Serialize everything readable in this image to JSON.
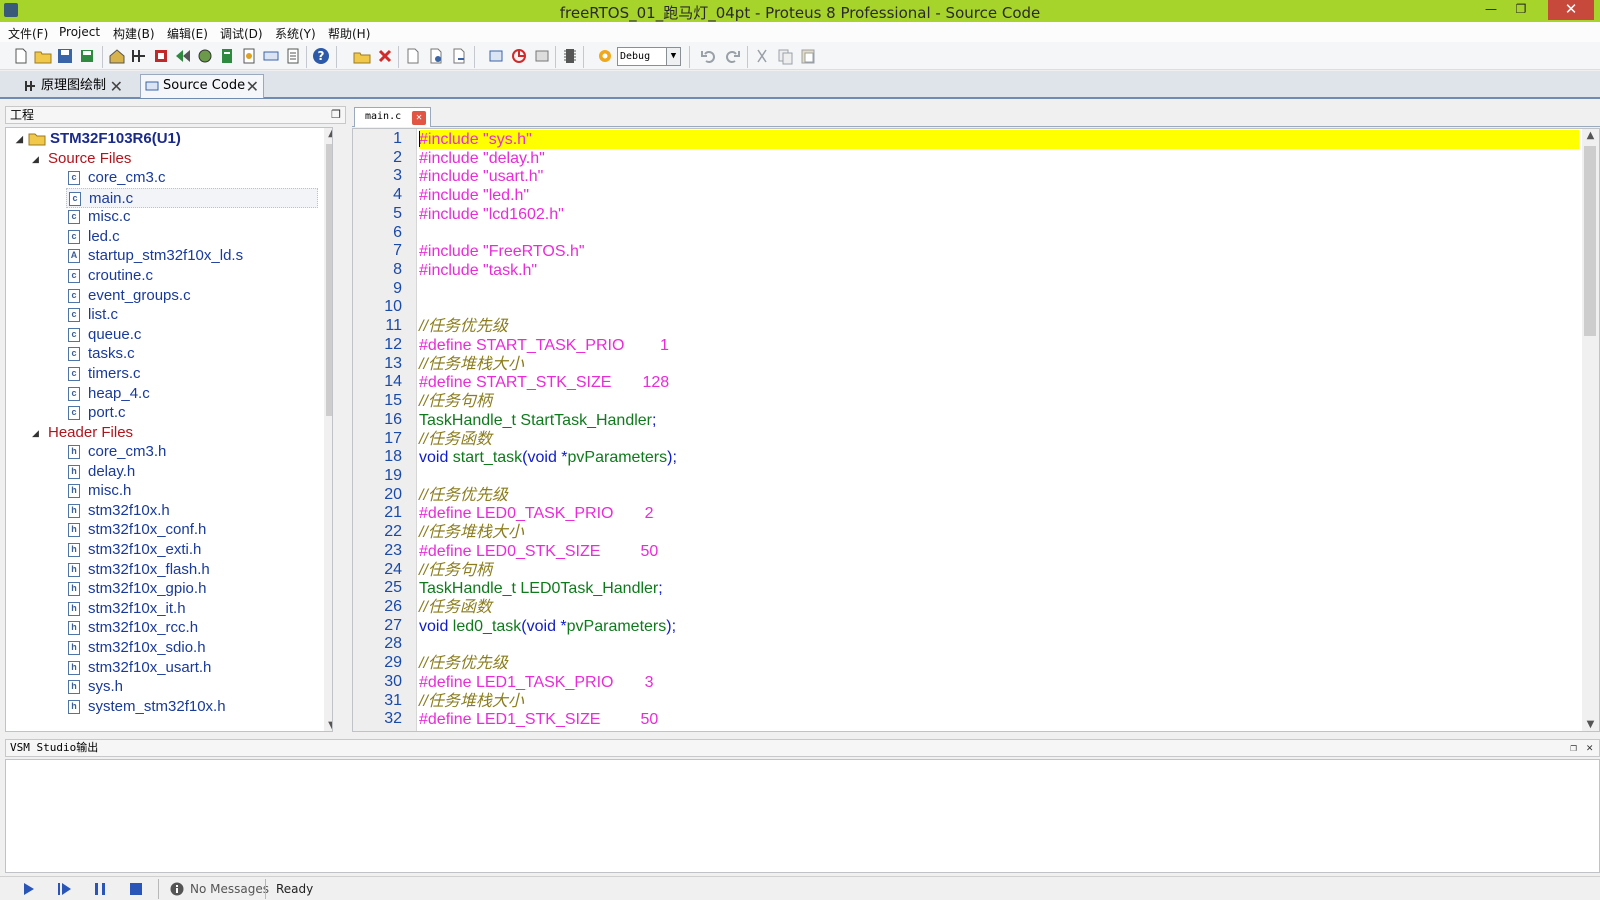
{
  "window": {
    "title": "freeRTOS_01_跑马灯_04pt - Proteus 8 Professional - Source Code",
    "minimize": "—",
    "restore": "❐",
    "close": "✕"
  },
  "menu": [
    "文件(F)",
    "Project",
    "构建(B)",
    "编辑(E)",
    "调试(D)",
    "系统(Y)",
    "帮助(H)"
  ],
  "toolbar": {
    "build_config": "Debug"
  },
  "doc_tabs": [
    {
      "label": "原理图绘制",
      "icon": "schematic-icon"
    },
    {
      "label": "Source Code",
      "icon": "source-code-icon"
    }
  ],
  "project_panel": {
    "header": "工程",
    "root": "STM32F103R6(U1)",
    "source_group": "Source Files",
    "source_files": [
      {
        "name": "core_cm3.c",
        "type": "c"
      },
      {
        "name": "main.c",
        "type": "c"
      },
      {
        "name": "misc.c",
        "type": "c"
      },
      {
        "name": "led.c",
        "type": "c"
      },
      {
        "name": "startup_stm32f10x_ld.s",
        "type": "A"
      },
      {
        "name": "croutine.c",
        "type": "c"
      },
      {
        "name": "event_groups.c",
        "type": "c"
      },
      {
        "name": "list.c",
        "type": "c"
      },
      {
        "name": "queue.c",
        "type": "c"
      },
      {
        "name": "tasks.c",
        "type": "c"
      },
      {
        "name": "timers.c",
        "type": "c"
      },
      {
        "name": "heap_4.c",
        "type": "c"
      },
      {
        "name": "port.c",
        "type": "c"
      }
    ],
    "header_group": "Header Files",
    "header_files": [
      {
        "name": "core_cm3.h",
        "type": "h"
      },
      {
        "name": "delay.h",
        "type": "h"
      },
      {
        "name": "misc.h",
        "type": "h"
      },
      {
        "name": "stm32f10x.h",
        "type": "h"
      },
      {
        "name": "stm32f10x_conf.h",
        "type": "h"
      },
      {
        "name": "stm32f10x_exti.h",
        "type": "h"
      },
      {
        "name": "stm32f10x_flash.h",
        "type": "h"
      },
      {
        "name": "stm32f10x_gpio.h",
        "type": "h"
      },
      {
        "name": "stm32f10x_it.h",
        "type": "h"
      },
      {
        "name": "stm32f10x_rcc.h",
        "type": "h"
      },
      {
        "name": "stm32f10x_sdio.h",
        "type": "h"
      },
      {
        "name": "stm32f10x_usart.h",
        "type": "h"
      },
      {
        "name": "sys.h",
        "type": "h"
      },
      {
        "name": "system_stm32f10x.h",
        "type": "h"
      }
    ]
  },
  "editor": {
    "tab": "main.c",
    "lines": [
      {
        "n": "1",
        "t": [
          [
            "#include \"sys.h\"",
            "pp"
          ]
        ]
      },
      {
        "n": "2",
        "t": [
          [
            "#include \"delay.h\"",
            "pp"
          ]
        ]
      },
      {
        "n": "3",
        "t": [
          [
            "#include \"usart.h\"",
            "pp"
          ]
        ]
      },
      {
        "n": "4",
        "t": [
          [
            "#include \"led.h\"",
            "pp"
          ]
        ]
      },
      {
        "n": "5",
        "t": [
          [
            "#include \"lcd1602.h\"",
            "pp"
          ]
        ]
      },
      {
        "n": "6",
        "t": []
      },
      {
        "n": "7",
        "t": [
          [
            "#include \"FreeRTOS.h\"",
            "pp"
          ]
        ]
      },
      {
        "n": "8",
        "t": [
          [
            "#include \"task.h\"",
            "pp"
          ]
        ]
      },
      {
        "n": "9",
        "t": []
      },
      {
        "n": "10",
        "t": []
      },
      {
        "n": "11",
        "t": [
          [
            "//任务优先级",
            "cm"
          ]
        ]
      },
      {
        "n": "12",
        "t": [
          [
            "#define START_TASK_PRIO        1",
            "pp"
          ]
        ]
      },
      {
        "n": "13",
        "t": [
          [
            "//任务堆栈大小",
            "cm"
          ]
        ]
      },
      {
        "n": "14",
        "t": [
          [
            "#define START_STK_SIZE       128",
            "pp"
          ]
        ]
      },
      {
        "n": "15",
        "t": [
          [
            "//任务句柄",
            "cm"
          ]
        ]
      },
      {
        "n": "16",
        "t": [
          [
            "TaskHandle_t StartTask_Handler",
            "id"
          ],
          [
            ";",
            "pu"
          ]
        ]
      },
      {
        "n": "17",
        "t": [
          [
            "//任务函数",
            "cm"
          ]
        ]
      },
      {
        "n": "18",
        "t": [
          [
            "void",
            "kw"
          ],
          [
            " start_task",
            "id"
          ],
          [
            "(",
            "pu"
          ],
          [
            "void",
            "kw"
          ],
          [
            " *",
            "pu"
          ],
          [
            "pvParameters",
            "id"
          ],
          [
            ");",
            "pu"
          ]
        ]
      },
      {
        "n": "19",
        "t": []
      },
      {
        "n": "20",
        "t": [
          [
            "//任务优先级",
            "cm"
          ]
        ]
      },
      {
        "n": "21",
        "t": [
          [
            "#define LED0_TASK_PRIO       2",
            "pp"
          ]
        ]
      },
      {
        "n": "22",
        "t": [
          [
            "//任务堆栈大小",
            "cm"
          ]
        ]
      },
      {
        "n": "23",
        "t": [
          [
            "#define LED0_STK_SIZE         50",
            "pp"
          ]
        ]
      },
      {
        "n": "24",
        "t": [
          [
            "//任务句柄",
            "cm"
          ]
        ]
      },
      {
        "n": "25",
        "t": [
          [
            "TaskHandle_t LED0Task_Handler",
            "id"
          ],
          [
            ";",
            "pu"
          ]
        ]
      },
      {
        "n": "26",
        "t": [
          [
            "//任务函数",
            "cm"
          ]
        ]
      },
      {
        "n": "27",
        "t": [
          [
            "void",
            "kw"
          ],
          [
            " led0_task",
            "id"
          ],
          [
            "(",
            "pu"
          ],
          [
            "void",
            "kw"
          ],
          [
            " *",
            "pu"
          ],
          [
            "pvParameters",
            "id"
          ],
          [
            ");",
            "pu"
          ]
        ]
      },
      {
        "n": "28",
        "t": []
      },
      {
        "n": "29",
        "t": [
          [
            "//任务优先级",
            "cm"
          ]
        ]
      },
      {
        "n": "30",
        "t": [
          [
            "#define LED1_TASK_PRIO       3",
            "pp"
          ]
        ]
      },
      {
        "n": "31",
        "t": [
          [
            "//任务堆栈大小",
            "cm"
          ]
        ]
      },
      {
        "n": "32",
        "t": [
          [
            "#define LED1_STK_SIZE         50",
            "pp"
          ]
        ]
      }
    ]
  },
  "output_panel": {
    "header": "VSM Studio输出"
  },
  "status": {
    "messages": "No Messages",
    "state": "Ready"
  },
  "colors": {
    "titlebar": "#a7d42b",
    "highlight_line": "#ffff00",
    "preprocessor": "#e92bd8",
    "comment": "#8b7d1d",
    "identifier": "#0f7a1c",
    "keyword": "#0e1cc9",
    "line_number": "#1a4aa8",
    "tree_group": "#b0151d",
    "tree_root": "#1a2a8a"
  }
}
